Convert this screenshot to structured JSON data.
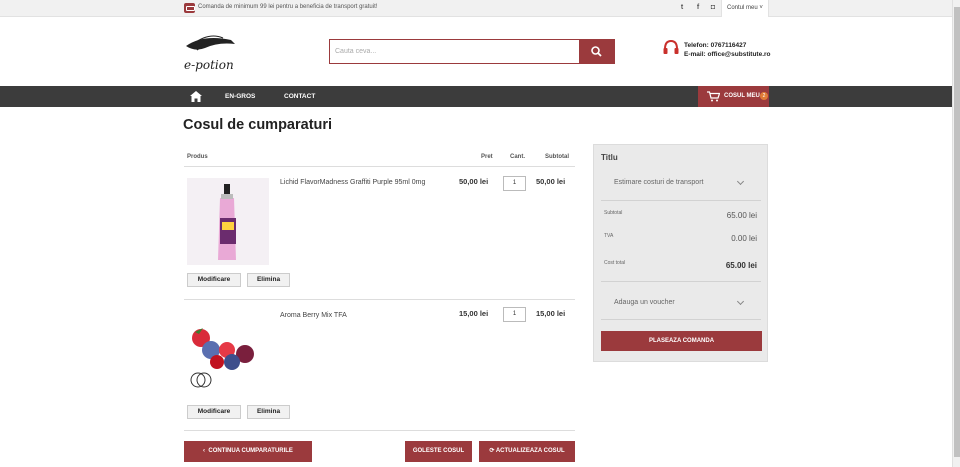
{
  "topbar": {
    "shipping_msg": "Comanda de minimum 99 lei pentru a beneficia de transport gratuit!",
    "social": [
      "twitter-icon",
      "facebook-icon",
      "instagram-icon"
    ],
    "account_label": "Contul meu"
  },
  "header": {
    "logo_text": "e-potion",
    "search_placeholder": "Cauta ceva...",
    "phone": "Telefon: 0767116427",
    "email": "E-mail: office@substitute.ro"
  },
  "nav": {
    "items": [
      "EN-GROS",
      "CONTACT"
    ],
    "cart_label": "COSUL MEU",
    "cart_count": "2"
  },
  "page_title": "Cosul de cumparaturi",
  "table": {
    "headers": {
      "product": "Produs",
      "price": "Pret",
      "qty": "Cant.",
      "subtotal": "Subtotal"
    },
    "rows": [
      {
        "name": "Lichid FlavorMadness Graffiti Purple 95ml 0mg",
        "price": "50,00 lei",
        "qty": "1",
        "subtotal": "50,00 lei",
        "edit_label": "Modificare",
        "delete_label": "Elimina"
      },
      {
        "name": "Aroma Berry Mix TFA",
        "price": "15,00 lei",
        "qty": "1",
        "subtotal": "15,00 lei",
        "edit_label": "Modificare",
        "delete_label": "Elimina"
      }
    ]
  },
  "buttons": {
    "continue": "CONTINUA CUMPARATURILE",
    "empty": "GOLESTE COSUL",
    "update": "ACTUALIZEAZA COSUL"
  },
  "summary": {
    "title": "Titlu",
    "shipping_estimate": "Estimare costuri de transport",
    "subtotal_label": "Subtotal",
    "subtotal_value": "65.00 lei",
    "tva_label": "TVA",
    "tva_value": "0.00 lei",
    "total_label": "Cost total",
    "total_value": "65.00 lei",
    "voucher": "Adauga un voucher",
    "place_order": "PLASEAZA COMANDA"
  },
  "colors": {
    "accent": "#9b3a3d",
    "nav_bg": "#3c3c3c",
    "badge": "#e07b36"
  }
}
